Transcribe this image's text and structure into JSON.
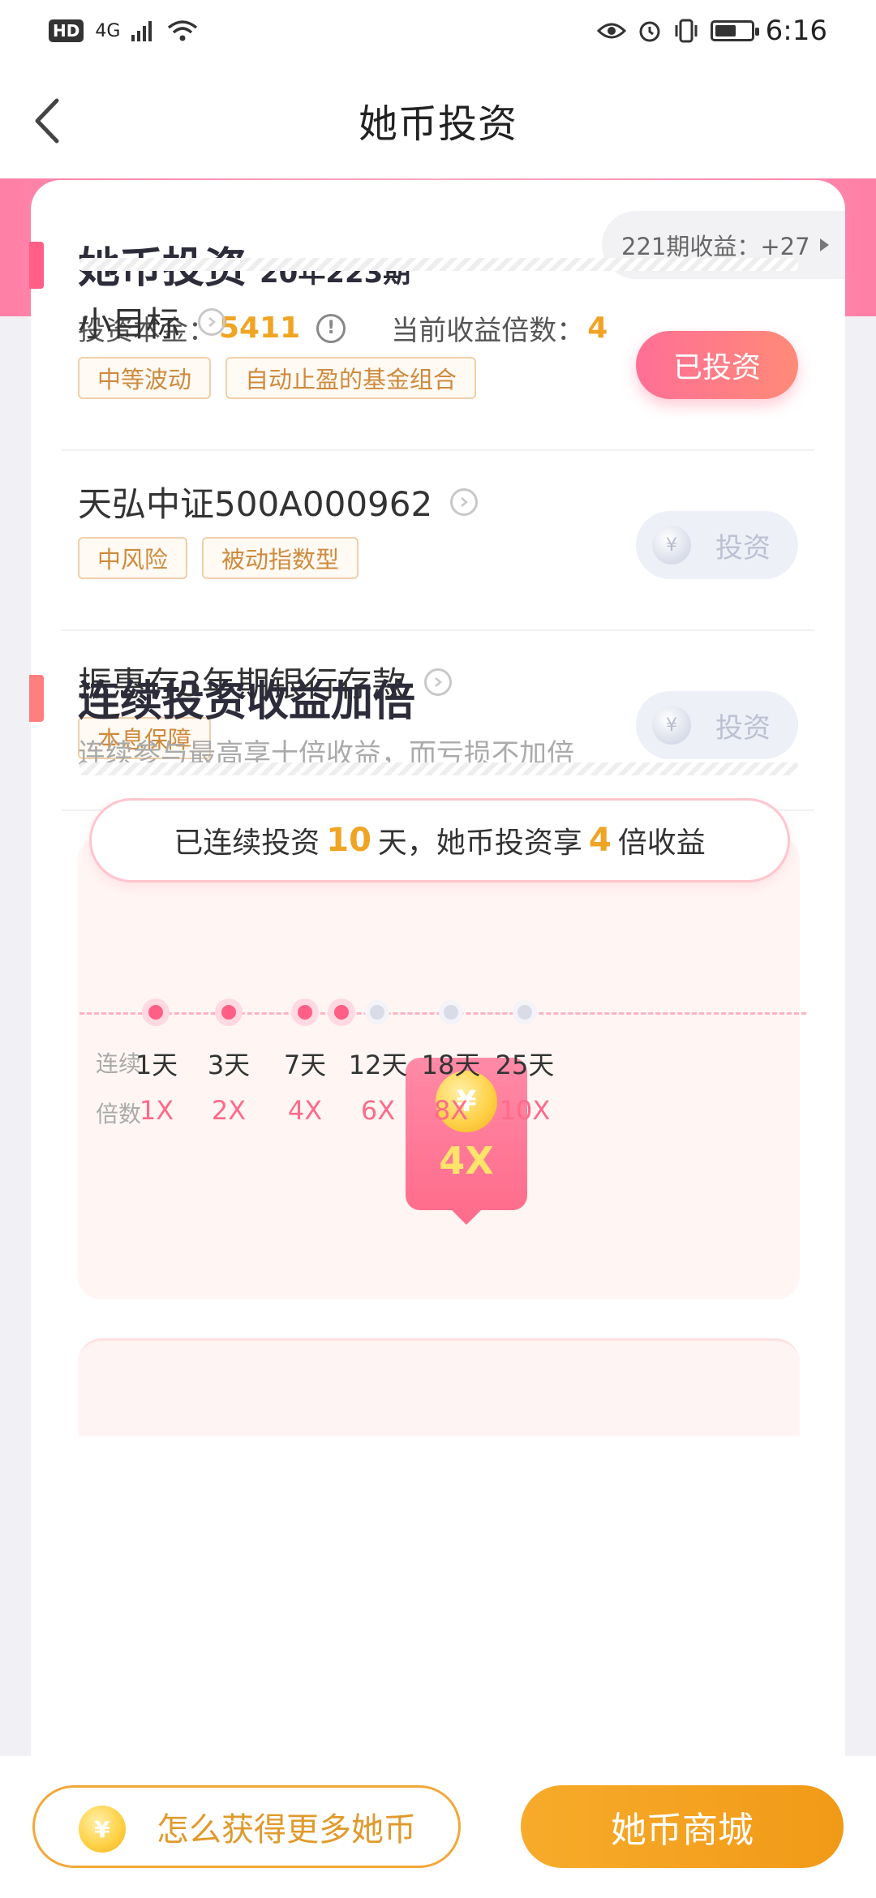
{
  "status_bar": {
    "hd_label": "HD",
    "network_label": "4G",
    "time": "6:16",
    "battery_level": 0.6
  },
  "nav": {
    "title": "她币投资"
  },
  "summary": {
    "title": "她币投资",
    "period": "20年223期",
    "prev_label": "221期收益：+27",
    "principal_label": "投资本金：",
    "principal_value": "5411",
    "multiplier_label": "当前收益倍数：",
    "multiplier_value": "4"
  },
  "items": [
    {
      "name": "小目标",
      "tags": [
        "中等波动",
        "自动止盈的基金组合"
      ],
      "button": "已投资",
      "invested": true
    },
    {
      "name": "天弘中证500A000962",
      "tags": [
        "中风险",
        "被动指数型"
      ],
      "button": "投资",
      "invested": false
    },
    {
      "name": "振惠存3年期银行存款",
      "tags": [
        "本息保障"
      ],
      "button": "投资",
      "invested": false
    }
  ],
  "bonus": {
    "title": "连续投资收益加倍",
    "subtitle": "连续参与最高享十倍收益，而亏损不加倍",
    "streak_prefix": "已连续投资",
    "streak_days": "10",
    "streak_mid": "天，她币投资享",
    "streak_mult": "4",
    "streak_suffix": "倍收益",
    "badge_coin": "¥",
    "badge_text": "4X",
    "row_label_days": "连续",
    "row_label_mult": "倍数",
    "milestones": [
      {
        "day": "1天",
        "mult": "1X"
      },
      {
        "day": "3天",
        "mult": "2X"
      },
      {
        "day": "7天",
        "mult": "4X"
      },
      {
        "day": "12天",
        "mult": "6X"
      },
      {
        "day": "18天",
        "mult": "8X"
      },
      {
        "day": "25天",
        "mult": "10X"
      }
    ]
  },
  "bottom": {
    "earn_coin": "¥",
    "earn_label": "怎么获得更多她币",
    "mall_label": "她币商城"
  },
  "colors": {
    "accent_pink": "#ff6f95",
    "accent_gold": "#f0a424",
    "mall_orange": "#f19a18"
  }
}
